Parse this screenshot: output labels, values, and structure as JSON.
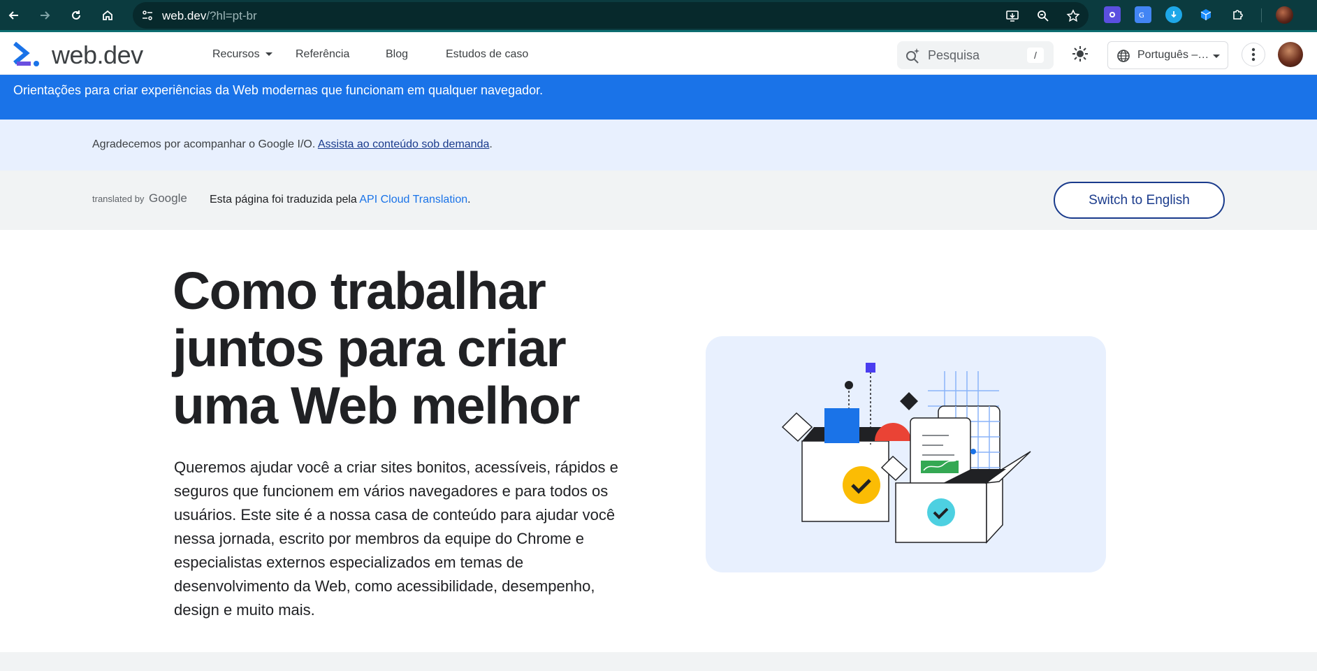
{
  "browser": {
    "url_host": "web.dev",
    "url_path": "/?hl=pt-br"
  },
  "header": {
    "logo_text": "web.dev",
    "nav": [
      {
        "label": "Recursos"
      },
      {
        "label": "Referência"
      },
      {
        "label": "Blog"
      },
      {
        "label": "Estudos de caso"
      }
    ],
    "search_placeholder": "Pesquisa",
    "search_shortcut": "/",
    "language_label": "Português –…"
  },
  "banner": {
    "text": "Orientações para criar experiências da Web modernas que funcionam em qualquer navegador."
  },
  "io_notice": {
    "text": "Agradecemos por acompanhar o Google I/O.",
    "link": "Assista ao conteúdo sob demanda",
    "suffix": "."
  },
  "translation": {
    "translated_by": "translated by",
    "brand": "Google",
    "message": "Esta página foi traduzida pela",
    "api_link": "API Cloud Translation",
    "suffix": ".",
    "switch_label": "Switch to English"
  },
  "hero": {
    "title_lines": [
      "Como trabalhar",
      "juntos para criar",
      "uma Web melhor"
    ],
    "description": "Queremos ajudar você a criar sites bonitos, acessíveis, rápidos e seguros que funcionem em vários navegadores e para todos os usuários. Este site é a nossa casa de conteúdo para ajudar você nessa jornada, escrito por membros da equipe do Chrome e especialistas externos especializados em temas de desenvolvimento da Web, como acessibilidade, desempenho, design e muito mais."
  },
  "colors": {
    "chrome_bg": "#0b3b3f",
    "banner_blue": "#1a73e8",
    "notice_bg": "#e8f0fe",
    "link_dark": "#1a3b8c"
  },
  "icons": [
    "back-icon",
    "forward-icon",
    "reload-icon",
    "home-icon",
    "site-info-icon",
    "install-app-icon",
    "zoom-icon",
    "bookmark-star-icon",
    "extension-icon",
    "search-icon",
    "theme-toggle-icon",
    "globe-icon",
    "more-vert-icon"
  ]
}
